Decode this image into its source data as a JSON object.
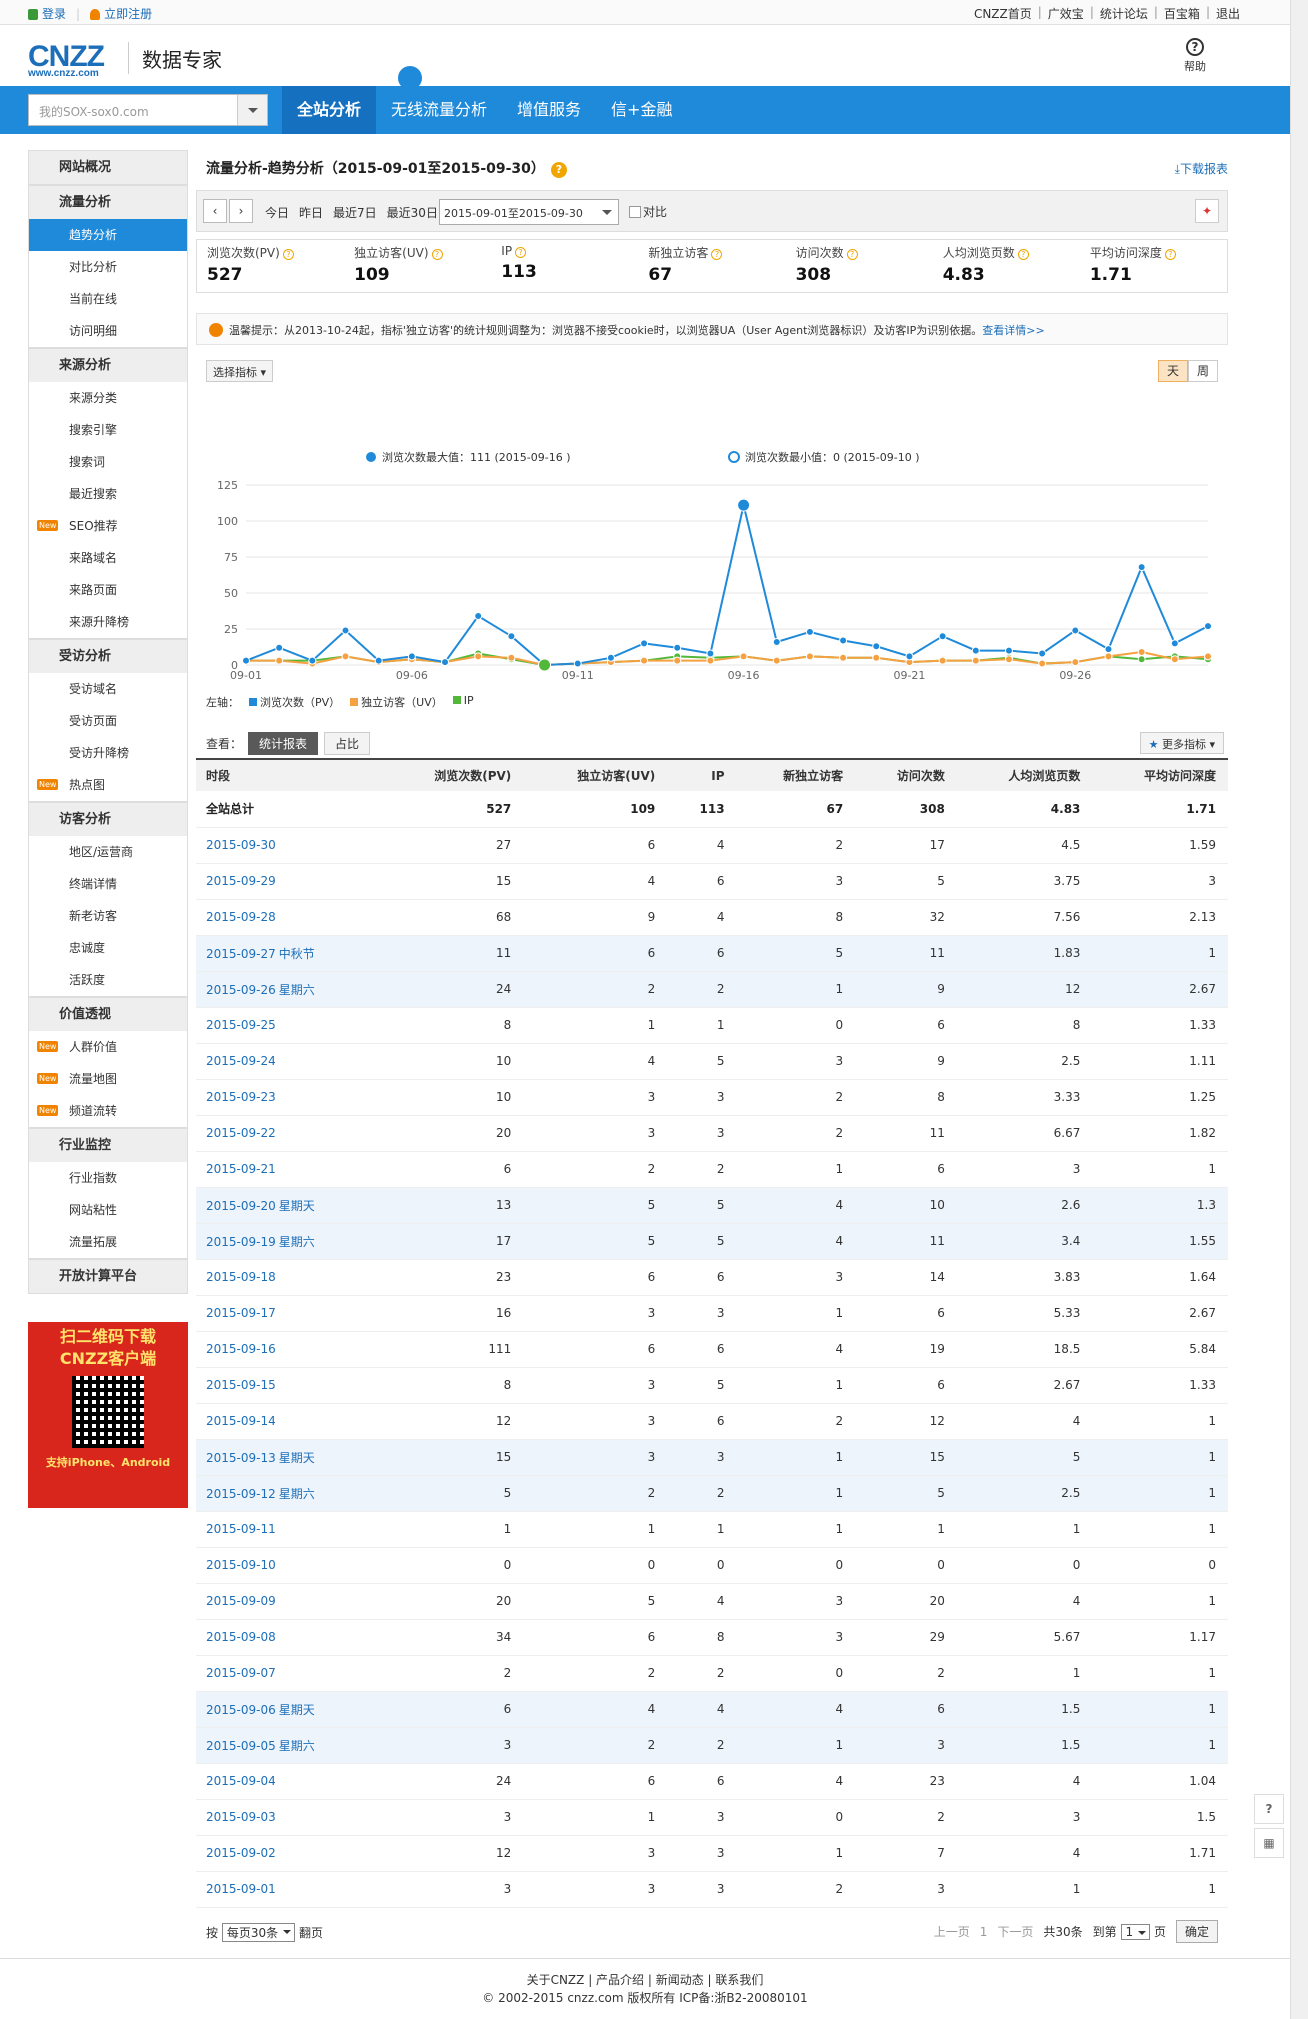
{
  "topbar": {
    "login": "登录",
    "register": "立即注册",
    "links": [
      "CNZZ首页",
      "广效宝",
      "统计论坛",
      "百宝箱",
      "退出"
    ]
  },
  "header": {
    "logo": "CNZZ",
    "logo_url": "www.cnzz.com",
    "product": "数据专家",
    "help": "帮助"
  },
  "nav": {
    "search_placeholder": "我的SOX-sox0.com",
    "items": [
      "全站分析",
      "无线流量分析",
      "增值服务",
      "信+金融"
    ]
  },
  "sidebar": [
    {
      "title": "网站概况",
      "items": []
    },
    {
      "title": "流量分析",
      "items": [
        "趋势分析",
        "对比分析",
        "当前在线",
        "访问明细"
      ]
    },
    {
      "title": "来源分析",
      "items": [
        "来源分类",
        "搜索引擎",
        "搜索词",
        "最近搜索",
        "SEO推荐",
        "来路域名",
        "来路页面",
        "来源升降榜"
      ]
    },
    {
      "title": "受访分析",
      "items": [
        "受访域名",
        "受访页面",
        "受访升降榜",
        "热点图"
      ]
    },
    {
      "title": "访客分析",
      "items": [
        "地区/运营商",
        "终端详情",
        "新老访客",
        "忠诚度",
        "活跃度"
      ]
    },
    {
      "title": "价值透视",
      "items": [
        "人群价值",
        "流量地图",
        "频道流转"
      ]
    },
    {
      "title": "行业监控",
      "items": [
        "行业指数",
        "网站粘性",
        "流量拓展"
      ]
    },
    {
      "title": "开放计算平台",
      "items": []
    }
  ],
  "new_badge": "New",
  "qr": {
    "title1": "扫二维码下载",
    "title2": "CNZZ客户端",
    "subtitle": "支持iPhone、Android"
  },
  "page": {
    "title": "流量分析-趋势分析（2015-09-01至2015-09-30）",
    "download": "下载报表"
  },
  "toolbar": {
    "quick": [
      "今日",
      "昨日",
      "最近7日",
      "最近30日"
    ],
    "range": "2015-09-01至2015-09-30",
    "compare": "对比"
  },
  "kpis": [
    {
      "label": "浏览次数(PV)",
      "value": "527"
    },
    {
      "label": "独立访客(UV)",
      "value": "109"
    },
    {
      "label": "IP",
      "value": "113"
    },
    {
      "label": "新独立访客",
      "value": "67"
    },
    {
      "label": "访问次数",
      "value": "308"
    },
    {
      "label": "人均浏览页数",
      "value": "4.83"
    },
    {
      "label": "平均访问深度",
      "value": "1.71"
    }
  ],
  "notice": {
    "text": "温馨提示：从2013-10-24起，指标'独立访客'的统计规则调整为：浏览器不接受cookie时，以浏览器UA（User Agent浏览器标识）及访客IP为识别依据。",
    "link": "查看详情>>"
  },
  "chart_controls": {
    "select_metric": "选择指标",
    "day": "天",
    "week": "周"
  },
  "chart_data": {
    "type": "line",
    "x": [
      "09-01",
      "09-02",
      "09-03",
      "09-04",
      "09-05",
      "09-06",
      "09-07",
      "09-08",
      "09-09",
      "09-10",
      "09-11",
      "09-12",
      "09-13",
      "09-14",
      "09-15",
      "09-16",
      "09-17",
      "09-18",
      "09-19",
      "09-20",
      "09-21",
      "09-22",
      "09-23",
      "09-24",
      "09-25",
      "09-26",
      "09-27",
      "09-28",
      "09-29",
      "09-30"
    ],
    "xticks": [
      "09-01",
      "09-06",
      "09-11",
      "09-16",
      "09-21",
      "09-26"
    ],
    "yticks": [
      "0",
      "25",
      "50",
      "75",
      "100",
      "125"
    ],
    "ylim": [
      0,
      125
    ],
    "max_label": "浏览次数最大值：111 (2015-09-16 )",
    "min_label": "浏览次数最小值：0 (2015-09-10 )",
    "axis_label": "左轴：",
    "series": [
      {
        "name": "浏览次数（PV）",
        "color": "#1f8ad9",
        "values": [
          3,
          12,
          3,
          24,
          3,
          6,
          2,
          34,
          20,
          0,
          1,
          5,
          15,
          12,
          8,
          111,
          16,
          23,
          17,
          13,
          6,
          20,
          10,
          10,
          8,
          24,
          11,
          68,
          15,
          27
        ]
      },
      {
        "name": "独立访客（UV）",
        "color": "#f5a142",
        "values": [
          3,
          3,
          1,
          6,
          2,
          4,
          2,
          6,
          5,
          0,
          1,
          2,
          3,
          3,
          3,
          6,
          3,
          6,
          5,
          5,
          2,
          3,
          3,
          4,
          1,
          2,
          6,
          9,
          4,
          6
        ]
      },
      {
        "name": "IP",
        "color": "#52b83a",
        "values": [
          3,
          3,
          3,
          6,
          2,
          4,
          2,
          8,
          4,
          0,
          1,
          2,
          3,
          6,
          5,
          6,
          3,
          6,
          5,
          5,
          2,
          3,
          3,
          5,
          1,
          2,
          6,
          4,
          6,
          4
        ]
      }
    ]
  },
  "view": {
    "label": "查看：",
    "tabs": [
      "统计报表",
      "占比"
    ],
    "more": "更多指标"
  },
  "table": {
    "headers": [
      "时段",
      "浏览次数(PV)",
      "独立访客(UV)",
      "IP",
      "新独立访客",
      "访问次数",
      "人均浏览页数",
      "平均访问深度"
    ],
    "total": [
      "全站总计",
      "527",
      "109",
      "113",
      "67",
      "308",
      "4.83",
      "1.71"
    ],
    "rows": [
      {
        "date": "2015-09-30",
        "tag": "",
        "weekend": false,
        "v": [
          "27",
          "6",
          "4",
          "2",
          "17",
          "4.5",
          "1.59"
        ]
      },
      {
        "date": "2015-09-29",
        "tag": "",
        "weekend": false,
        "v": [
          "15",
          "4",
          "6",
          "3",
          "5",
          "3.75",
          "3"
        ]
      },
      {
        "date": "2015-09-28",
        "tag": "",
        "weekend": false,
        "v": [
          "68",
          "9",
          "4",
          "8",
          "32",
          "7.56",
          "2.13"
        ]
      },
      {
        "date": "2015-09-27",
        "tag": "中秋节",
        "weekend": true,
        "v": [
          "11",
          "6",
          "6",
          "5",
          "11",
          "1.83",
          "1"
        ]
      },
      {
        "date": "2015-09-26",
        "tag": "星期六",
        "weekend": true,
        "v": [
          "24",
          "2",
          "2",
          "1",
          "9",
          "12",
          "2.67"
        ]
      },
      {
        "date": "2015-09-25",
        "tag": "",
        "weekend": false,
        "v": [
          "8",
          "1",
          "1",
          "0",
          "6",
          "8",
          "1.33"
        ]
      },
      {
        "date": "2015-09-24",
        "tag": "",
        "weekend": false,
        "v": [
          "10",
          "4",
          "5",
          "3",
          "9",
          "2.5",
          "1.11"
        ]
      },
      {
        "date": "2015-09-23",
        "tag": "",
        "weekend": false,
        "v": [
          "10",
          "3",
          "3",
          "2",
          "8",
          "3.33",
          "1.25"
        ]
      },
      {
        "date": "2015-09-22",
        "tag": "",
        "weekend": false,
        "v": [
          "20",
          "3",
          "3",
          "2",
          "11",
          "6.67",
          "1.82"
        ]
      },
      {
        "date": "2015-09-21",
        "tag": "",
        "weekend": false,
        "v": [
          "6",
          "2",
          "2",
          "1",
          "6",
          "3",
          "1"
        ]
      },
      {
        "date": "2015-09-20",
        "tag": "星期天",
        "weekend": true,
        "v": [
          "13",
          "5",
          "5",
          "4",
          "10",
          "2.6",
          "1.3"
        ]
      },
      {
        "date": "2015-09-19",
        "tag": "星期六",
        "weekend": true,
        "v": [
          "17",
          "5",
          "5",
          "4",
          "11",
          "3.4",
          "1.55"
        ]
      },
      {
        "date": "2015-09-18",
        "tag": "",
        "weekend": false,
        "v": [
          "23",
          "6",
          "6",
          "3",
          "14",
          "3.83",
          "1.64"
        ]
      },
      {
        "date": "2015-09-17",
        "tag": "",
        "weekend": false,
        "v": [
          "16",
          "3",
          "3",
          "1",
          "6",
          "5.33",
          "2.67"
        ]
      },
      {
        "date": "2015-09-16",
        "tag": "",
        "weekend": false,
        "v": [
          "111",
          "6",
          "6",
          "4",
          "19",
          "18.5",
          "5.84"
        ]
      },
      {
        "date": "2015-09-15",
        "tag": "",
        "weekend": false,
        "v": [
          "8",
          "3",
          "5",
          "1",
          "6",
          "2.67",
          "1.33"
        ]
      },
      {
        "date": "2015-09-14",
        "tag": "",
        "weekend": false,
        "v": [
          "12",
          "3",
          "6",
          "2",
          "12",
          "4",
          "1"
        ]
      },
      {
        "date": "2015-09-13",
        "tag": "星期天",
        "weekend": true,
        "v": [
          "15",
          "3",
          "3",
          "1",
          "15",
          "5",
          "1"
        ]
      },
      {
        "date": "2015-09-12",
        "tag": "星期六",
        "weekend": true,
        "v": [
          "5",
          "2",
          "2",
          "1",
          "5",
          "2.5",
          "1"
        ]
      },
      {
        "date": "2015-09-11",
        "tag": "",
        "weekend": false,
        "v": [
          "1",
          "1",
          "1",
          "1",
          "1",
          "1",
          "1"
        ]
      },
      {
        "date": "2015-09-10",
        "tag": "",
        "weekend": false,
        "v": [
          "0",
          "0",
          "0",
          "0",
          "0",
          "0",
          "0"
        ]
      },
      {
        "date": "2015-09-09",
        "tag": "",
        "weekend": false,
        "v": [
          "20",
          "5",
          "4",
          "3",
          "20",
          "4",
          "1"
        ]
      },
      {
        "date": "2015-09-08",
        "tag": "",
        "weekend": false,
        "v": [
          "34",
          "6",
          "8",
          "3",
          "29",
          "5.67",
          "1.17"
        ]
      },
      {
        "date": "2015-09-07",
        "tag": "",
        "weekend": false,
        "v": [
          "2",
          "2",
          "2",
          "0",
          "2",
          "1",
          "1"
        ]
      },
      {
        "date": "2015-09-06",
        "tag": "星期天",
        "weekend": true,
        "v": [
          "6",
          "4",
          "4",
          "4",
          "6",
          "1.5",
          "1"
        ]
      },
      {
        "date": "2015-09-05",
        "tag": "星期六",
        "weekend": true,
        "v": [
          "3",
          "2",
          "2",
          "1",
          "3",
          "1.5",
          "1"
        ]
      },
      {
        "date": "2015-09-04",
        "tag": "",
        "weekend": false,
        "v": [
          "24",
          "6",
          "6",
          "4",
          "23",
          "4",
          "1.04"
        ]
      },
      {
        "date": "2015-09-03",
        "tag": "",
        "weekend": false,
        "v": [
          "3",
          "1",
          "3",
          "0",
          "2",
          "3",
          "1.5"
        ]
      },
      {
        "date": "2015-09-02",
        "tag": "",
        "weekend": false,
        "v": [
          "12",
          "3",
          "3",
          "1",
          "7",
          "4",
          "1.71"
        ]
      },
      {
        "date": "2015-09-01",
        "tag": "",
        "weekend": false,
        "v": [
          "3",
          "3",
          "3",
          "2",
          "3",
          "1",
          "1"
        ]
      }
    ]
  },
  "pager": {
    "by": "按",
    "per_page": "每页30条",
    "flip": "翻页",
    "prev": "上一页",
    "page": "1",
    "next": "下一页",
    "total": "共30条",
    "goto": "到第",
    "goto_val": "1",
    "page_unit": "页",
    "confirm": "确定"
  },
  "footer": {
    "links": "关于CNZZ | 产品介绍 | 新闻动态 | 联系我们",
    "copyright": "© 2002-2015 cnzz.com 版权所有 ICP备:浙B2-20080101"
  },
  "float": {
    "help": "?",
    "qr": "▦"
  }
}
